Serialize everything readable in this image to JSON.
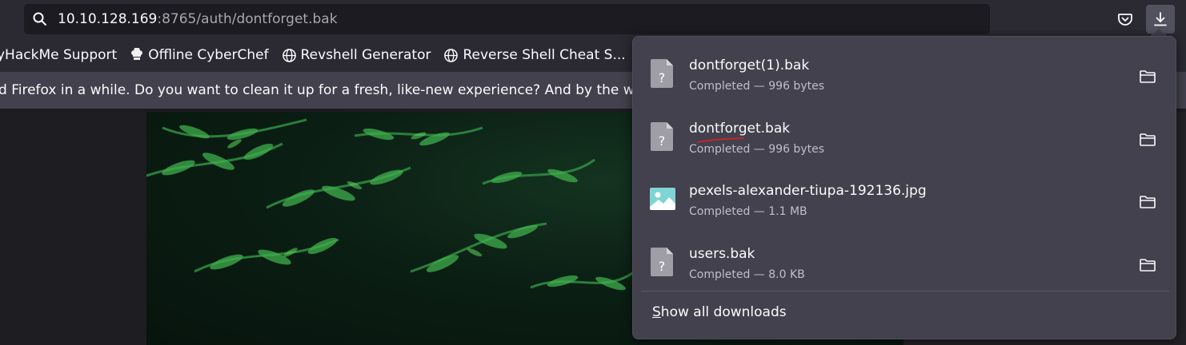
{
  "urlbar": {
    "host": "10.10.128.169",
    "path": ":8765/auth/dontforget.bak",
    "search_icon": "search-icon"
  },
  "toolbar": {
    "pocket_icon": "pocket-icon",
    "downloads_icon": "download-arrow-icon"
  },
  "bookmarks": [
    {
      "label": "yHackMe Support",
      "icon": "none"
    },
    {
      "label": "Offline CyberChef",
      "icon": "chef-hat-icon"
    },
    {
      "label": "Revshell Generator",
      "icon": "globe-icon"
    },
    {
      "label": "Reverse Shell Cheat S...",
      "icon": "globe-icon"
    }
  ],
  "notification": {
    "text": "d Firefox in a while. Do you want to clean it up for a fresh, like-new experience? And by the way,"
  },
  "downloads": {
    "items": [
      {
        "name": "dontforget(1).bak",
        "status": "Completed — 996 bytes",
        "icon": "unknown-file-icon"
      },
      {
        "name": "dontforget.bak",
        "status": "Completed — 996 bytes",
        "icon": "unknown-file-icon"
      },
      {
        "name": "pexels-alexander-tiupa-192136.jpg",
        "status": "Completed — 1.1 MB",
        "icon": "image-file-icon"
      },
      {
        "name": "users.bak",
        "status": "Completed — 8.0 KB",
        "icon": "unknown-file-icon"
      }
    ],
    "show_all_access_key": "S",
    "show_all_rest": "how all downloads"
  },
  "colors": {
    "toolbar_bg": "#2b2a33",
    "panel_bg": "#42414d",
    "image_icon": "#7fd4d4",
    "annotation_red": "#c0262d"
  }
}
